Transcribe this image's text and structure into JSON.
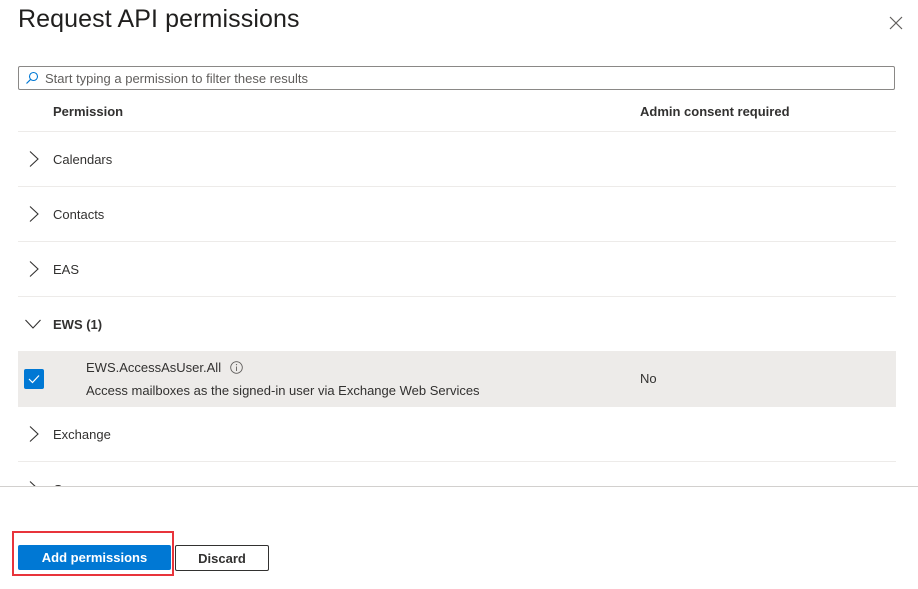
{
  "dialog": {
    "title": "Request API permissions",
    "close_icon": "close-icon"
  },
  "search": {
    "placeholder": "Start typing a permission to filter these results",
    "value": "",
    "icon": "search-icon"
  },
  "table": {
    "columns": [
      "Permission",
      "Admin consent required"
    ],
    "groups": [
      {
        "label": "Calendars",
        "expanded": false
      },
      {
        "label": "Contacts",
        "expanded": false
      },
      {
        "label": "EAS",
        "expanded": false
      },
      {
        "label": "EWS (1)",
        "expanded": true,
        "permissions": [
          {
            "name": "EWS.AccessAsUser.All",
            "description": "Access mailboxes as the signed-in user via Exchange Web Services",
            "admin_consent": "No",
            "checked": true
          }
        ]
      },
      {
        "label": "Exchange",
        "expanded": false
      },
      {
        "label": "G",
        "expanded": false
      }
    ]
  },
  "footer": {
    "primary_label": "Add permissions",
    "secondary_label": "Discard"
  },
  "colors": {
    "accent": "#0078d4",
    "highlight": "#e8343b",
    "selected_row": "#edebe9"
  }
}
